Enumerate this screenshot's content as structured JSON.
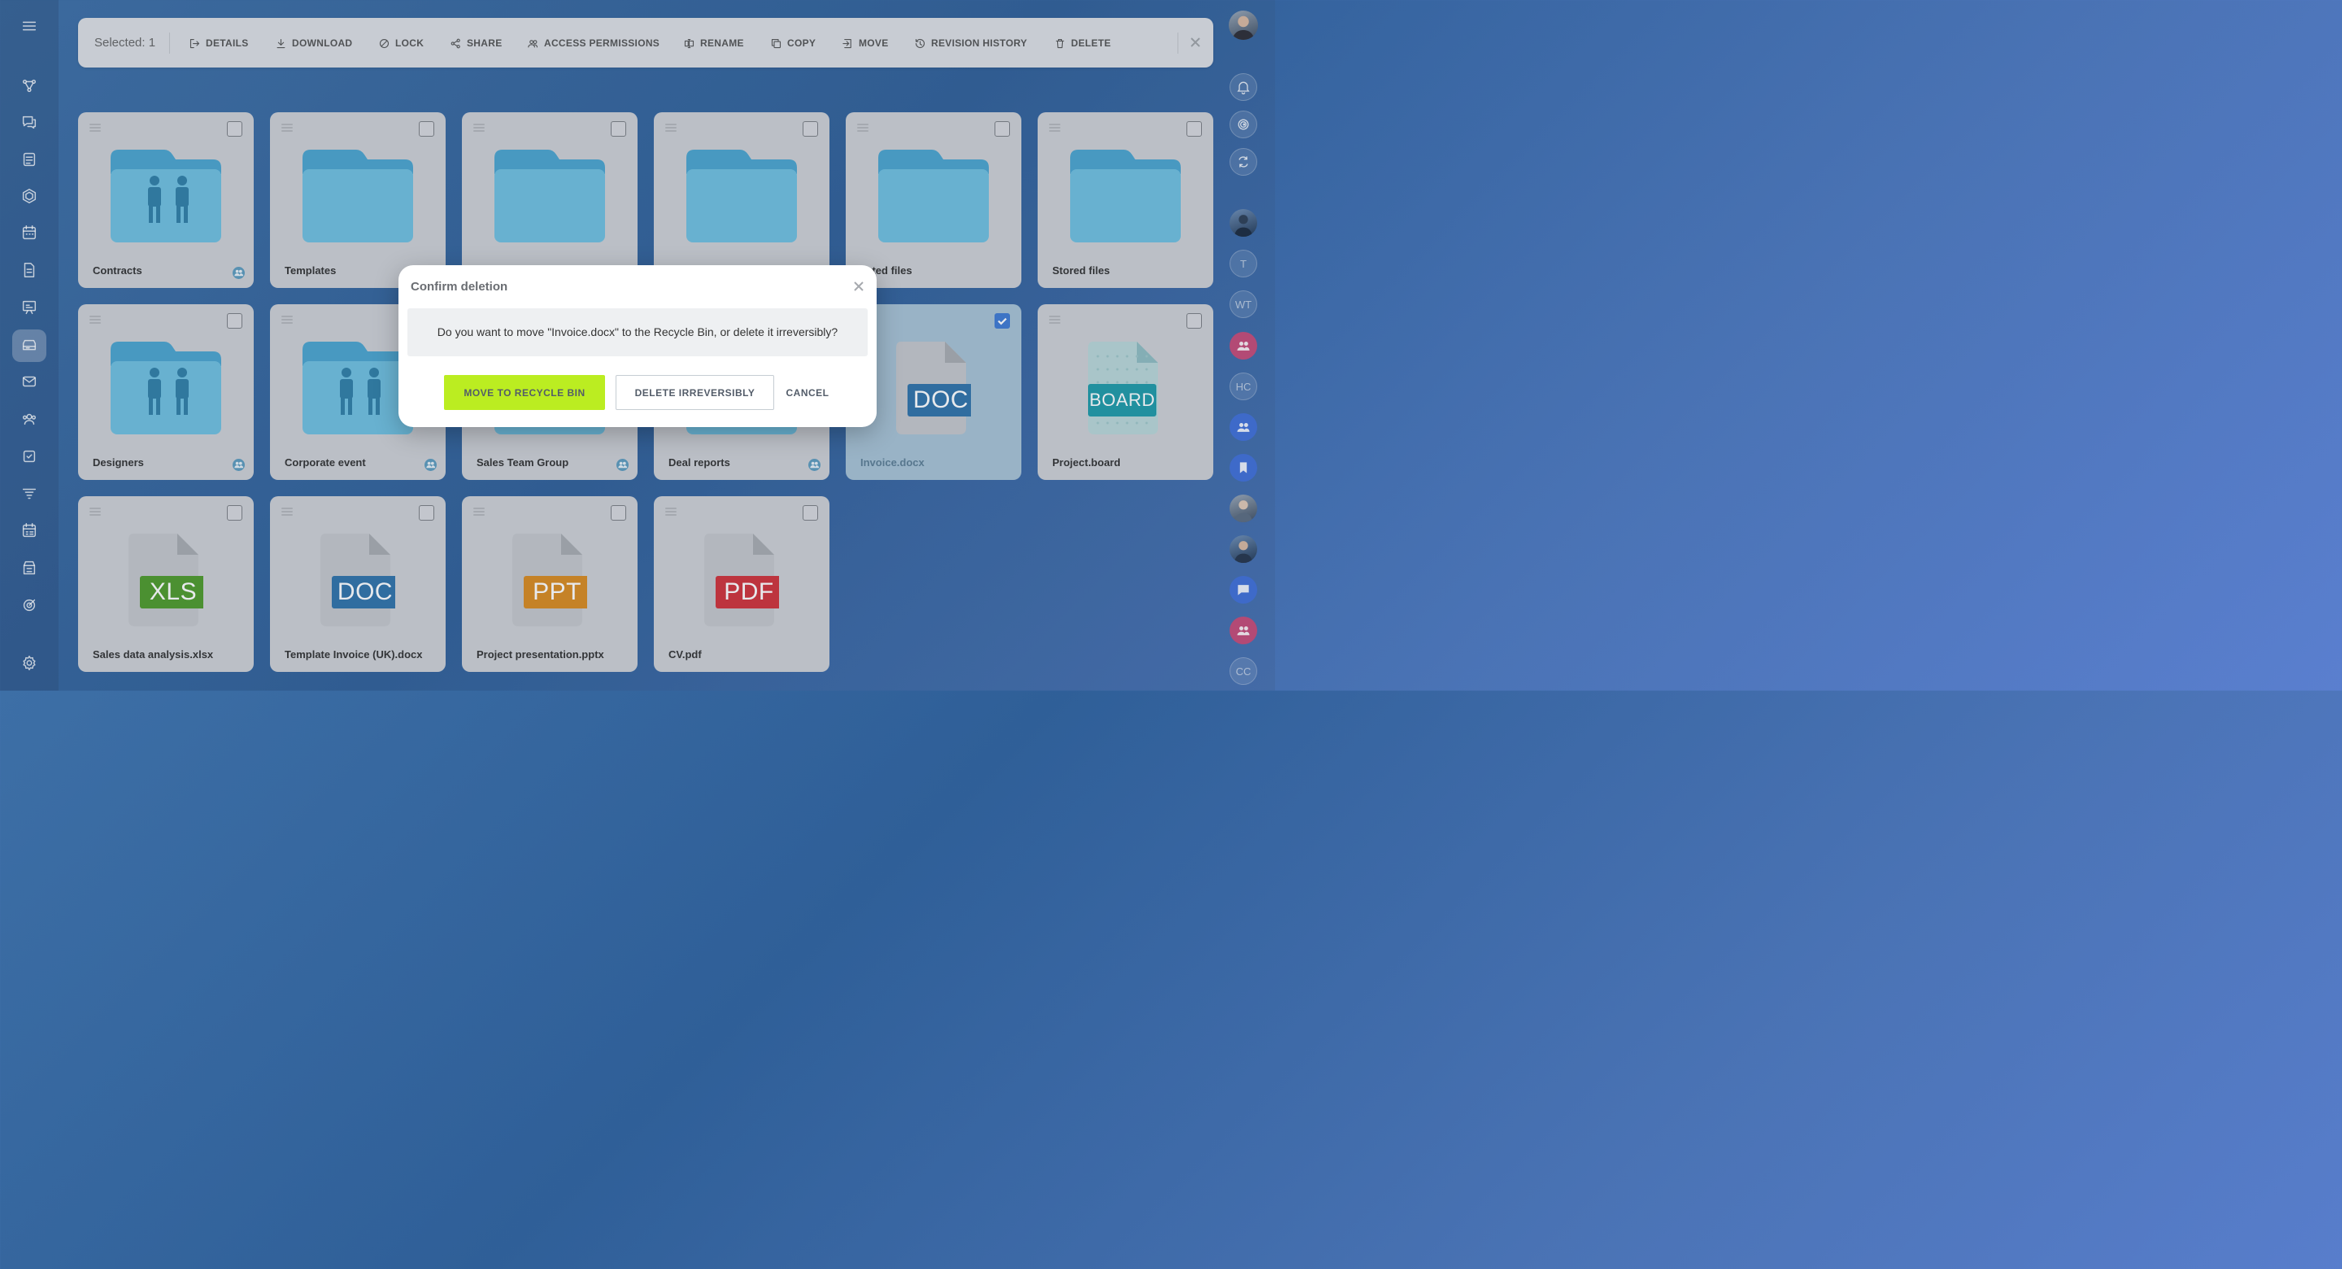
{
  "toolbar": {
    "selected_label": "Selected: 1",
    "actions": [
      {
        "label": "DETAILS",
        "icon": "details-icon"
      },
      {
        "label": "DOWNLOAD",
        "icon": "download-icon"
      },
      {
        "label": "LOCK",
        "icon": "lock-icon"
      },
      {
        "label": "SHARE",
        "icon": "share-icon"
      },
      {
        "label": "ACCESS PERMISSIONS",
        "icon": "users-icon"
      },
      {
        "label": "RENAME",
        "icon": "rename-icon"
      },
      {
        "label": "COPY",
        "icon": "copy-icon"
      },
      {
        "label": "MOVE",
        "icon": "move-icon"
      },
      {
        "label": "REVISION HISTORY",
        "icon": "history-icon"
      },
      {
        "label": "DELETE",
        "icon": "trash-icon"
      }
    ]
  },
  "files": [
    {
      "name": "Contracts",
      "kind": "folder",
      "shared": true
    },
    {
      "name": "Templates",
      "kind": "folder",
      "shared": false
    },
    {
      "name": "",
      "kind": "folder",
      "shared": false
    },
    {
      "name": "",
      "kind": "folder",
      "shared": false
    },
    {
      "name": "eated files",
      "kind": "folder",
      "shared": false
    },
    {
      "name": "Stored files",
      "kind": "folder",
      "shared": false
    },
    {
      "name": "Designers",
      "kind": "folder",
      "shared": true
    },
    {
      "name": "Corporate event",
      "kind": "folder",
      "shared": true
    },
    {
      "name": "Sales Team Group",
      "kind": "folder",
      "shared": true
    },
    {
      "name": "Deal reports",
      "kind": "folder",
      "shared": true
    },
    {
      "name": "Invoice.docx",
      "kind": "doc",
      "badge": "DOC",
      "badge_color": "#2f72a9",
      "selected": true
    },
    {
      "name": "Project.board",
      "kind": "board",
      "badge": "BOARD",
      "badge_color": "#1e9aa8"
    },
    {
      "name": "Sales data analysis.xlsx",
      "kind": "doc",
      "badge": "XLS",
      "badge_color": "#4e9a2b"
    },
    {
      "name": "Template Invoice (UK).docx",
      "kind": "doc",
      "badge": "DOC",
      "badge_color": "#2f72a9"
    },
    {
      "name": "Project presentation.pptx",
      "kind": "doc",
      "badge": "PPT",
      "badge_color": "#d98a1f"
    },
    {
      "name": "CV.pdf",
      "kind": "doc",
      "badge": "PDF",
      "badge_color": "#d0313a"
    }
  ],
  "modal": {
    "title": "Confirm deletion",
    "message": "Do you want to move \"Invoice.docx\" to the Recycle Bin, or delete it irreversibly?",
    "move_label": "MOVE TO RECYCLE BIN",
    "delete_label": "DELETE IRREVERSIBLY",
    "cancel_label": "CANCEL"
  },
  "right_sidebar": {
    "initials": [
      "T",
      "WT",
      "HC",
      "CC"
    ]
  },
  "colors": {
    "folder_front": "#6fc0e0",
    "folder_back": "#4aa4cf",
    "primary_button": "#bbed21",
    "checkbox_selected": "#3e7ad3"
  }
}
